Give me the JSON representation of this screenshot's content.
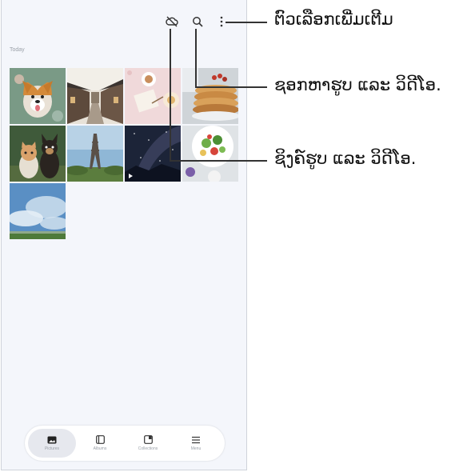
{
  "app": {
    "section_title": "Today",
    "nav": [
      {
        "label": "Pictures",
        "icon": "pictures-icon",
        "active": true
      },
      {
        "label": "Albums",
        "icon": "albums-icon",
        "active": false
      },
      {
        "label": "Collections",
        "icon": "collections-icon",
        "active": false
      },
      {
        "label": "Menu",
        "icon": "menu-icon",
        "active": false
      }
    ],
    "toolbar_icons": [
      "cloud-sync-off-icon",
      "search-icon",
      "more-options-icon"
    ]
  },
  "photos": [
    {
      "subject": "corgi",
      "video": false
    },
    {
      "subject": "street",
      "video": false
    },
    {
      "subject": "coffee-table",
      "video": false
    },
    {
      "subject": "pancakes",
      "video": false
    },
    {
      "subject": "cat-and-dog",
      "video": false
    },
    {
      "subject": "eiffel-tower",
      "video": false
    },
    {
      "subject": "night-sky",
      "video": true
    },
    {
      "subject": "salad",
      "video": false
    },
    {
      "subject": "sky",
      "video": false
    }
  ],
  "callouts": {
    "more_options": "ຕົວເລືອກເພີ່ມເຕີມ",
    "search": "ຊອກຫາຮູບ ແລະ ວິດີໂອ.",
    "sync": "ຊິງຄ໌ຮູບ ແລະ ວິດີໂອ."
  }
}
